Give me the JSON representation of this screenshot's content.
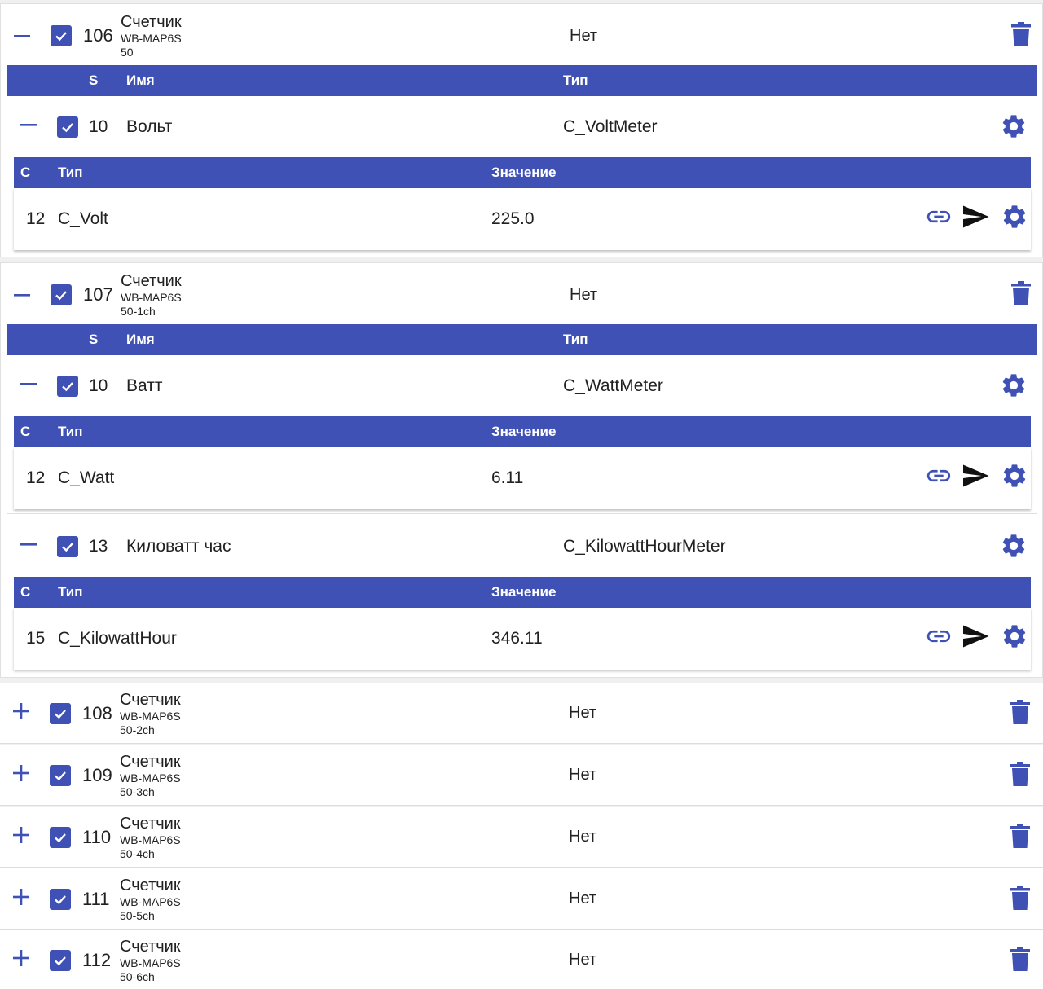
{
  "colors": {
    "primary": "#3f51b5",
    "header_text": "#ffffff"
  },
  "icons": {
    "collapse": "minus-icon",
    "expand": "plus-icon",
    "checked": "checkbox-checked-icon",
    "delete": "trash-icon",
    "settings": "gear-icon",
    "link": "link-icon",
    "send": "send-icon"
  },
  "sensor_table_headers": {
    "s": "S",
    "name": "Имя",
    "type": "Тип"
  },
  "value_table_headers": {
    "c": "C",
    "type": "Тип",
    "value": "Значение"
  },
  "devices": [
    {
      "id": "106",
      "name": "Счетчик",
      "model": "WB-MAP6S",
      "sub": "50",
      "status": "Нет",
      "expanded": true,
      "checked": true,
      "sensors": [
        {
          "id": "10",
          "name": "Вольт",
          "type": "C_VoltMeter",
          "checked": true,
          "values": [
            {
              "c": "12",
              "type": "C_Volt",
              "value": "225.0"
            }
          ]
        }
      ]
    },
    {
      "id": "107",
      "name": "Счетчик",
      "model": "WB-MAP6S",
      "sub": "50-1ch",
      "status": "Нет",
      "expanded": true,
      "checked": true,
      "sensors": [
        {
          "id": "10",
          "name": "Ватт",
          "type": "C_WattMeter",
          "checked": true,
          "values": [
            {
              "c": "12",
              "type": "C_Watt",
              "value": "6.11"
            }
          ]
        },
        {
          "id": "13",
          "name": "Киловатт час",
          "type": "C_KilowattHourMeter",
          "checked": true,
          "values": [
            {
              "c": "15",
              "type": "C_KilowattHour",
              "value": "346.11"
            }
          ]
        }
      ]
    },
    {
      "id": "108",
      "name": "Счетчик",
      "model": "WB-MAP6S",
      "sub": "50-2ch",
      "status": "Нет",
      "expanded": false,
      "checked": true
    },
    {
      "id": "109",
      "name": "Счетчик",
      "model": "WB-MAP6S",
      "sub": "50-3ch",
      "status": "Нет",
      "expanded": false,
      "checked": true
    },
    {
      "id": "110",
      "name": "Счетчик",
      "model": "WB-MAP6S",
      "sub": "50-4ch",
      "status": "Нет",
      "expanded": false,
      "checked": true
    },
    {
      "id": "111",
      "name": "Счетчик",
      "model": "WB-MAP6S",
      "sub": "50-5ch",
      "status": "Нет",
      "expanded": false,
      "checked": true
    },
    {
      "id": "112",
      "name": "Счетчик",
      "model": "WB-MAP6S",
      "sub": "50-6ch",
      "status": "Нет",
      "expanded": false,
      "checked": true
    }
  ]
}
